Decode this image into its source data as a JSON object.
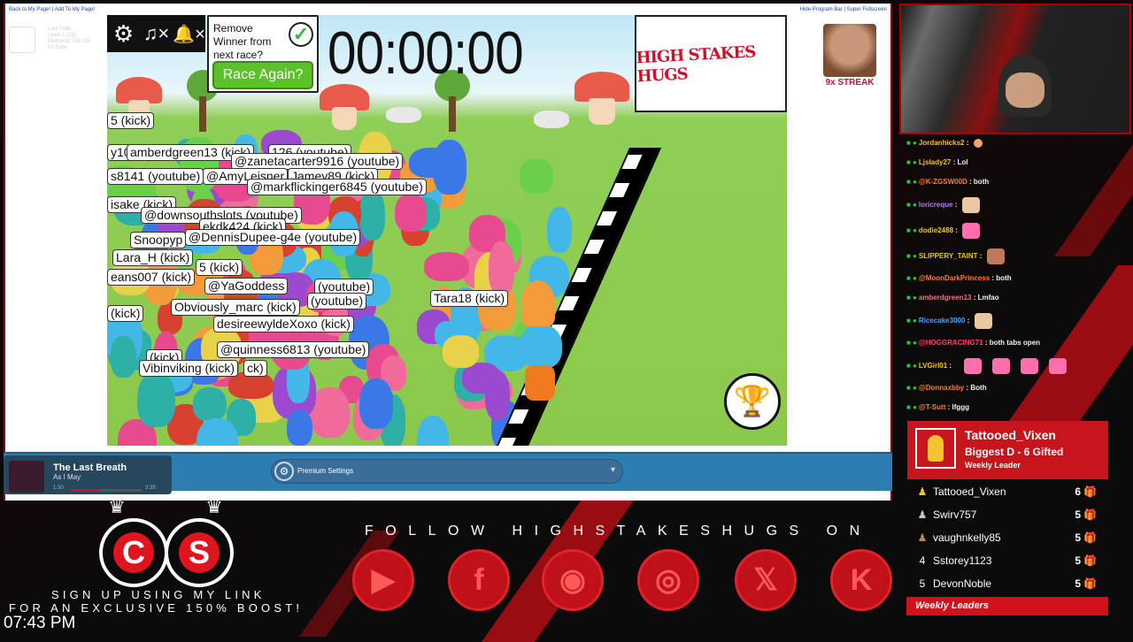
{
  "browser": {
    "top_left_links": "Back to My Page! | Add To My Page!",
    "top_right_links": "Hide Program Bar | Super Fullscreen",
    "ghost_profile": [
      "Last Train",
      "Level 1 (18)",
      "Elements:738 ±10",
      "10 Subs"
    ]
  },
  "game": {
    "timer": "00:00:00",
    "remove_winner_text": "Remove Winner from next race?",
    "race_again_label": "Race Again?",
    "logo_text": "HIGH STAKES HUGS",
    "streak_label": "9x STREAK",
    "name_tags": [
      "5 (kick)",
      "y10",
      "amberdgreen13 (kick)",
      "126 (youtube)",
      "@zanetacarter9916 (youtube)",
      "s8141 (youtube)",
      "@AmyLeisner",
      "Jamey89 (kick)",
      "@markflickinger6845 (youtube)",
      "isake (kick)",
      "@downsouthslots (youtube)",
      "ekdk424 (kick)",
      "Snoopyp",
      "@DennisDupee-g4e (youtube)",
      "Lara_H (kick)",
      "5 (kick)",
      "eans007 (kick)",
      "@YaGoddess",
      "(youtube)",
      "(youtube)",
      "Tara18 (kick)",
      "(kick)",
      "Obviously_marc (kick)",
      "desireewyldeXoxo (kick)",
      "@quinness6813 (youtube)",
      "(kick)",
      "Vibinviking (kick)",
      "ck)"
    ]
  },
  "music": {
    "title": "The Last Breath",
    "artist": "As I May",
    "time_current": "1:30",
    "time_total": "3:39"
  },
  "premium": {
    "label": "Premium Settings"
  },
  "chat": [
    {
      "name": "Jordanhicks2",
      "msg": "",
      "color": "#f0c419",
      "emote": "peach"
    },
    {
      "name": "Ljslady27",
      "msg": "Lol",
      "color": "#f0c419"
    },
    {
      "name": "@K-ZGSW00D",
      "msg": "both",
      "color": "#ff7b2e"
    },
    {
      "name": "loricreque",
      "msg": "",
      "color": "#b57cff",
      "emote": "cat"
    },
    {
      "name": "dodie2488",
      "msg": "",
      "color": "#f0c419",
      "emote": "pink"
    },
    {
      "name": "SLIPPERY_TAINT",
      "msg": "",
      "color": "#f0c419",
      "emote": "face"
    },
    {
      "name": "@MoonDarkPrincess",
      "msg": "both",
      "color": "#ff7b2e"
    },
    {
      "name": "amberdgreen13",
      "msg": "Lmfao",
      "color": "#ff6b8a"
    },
    {
      "name": "Ricecake3000",
      "msg": "",
      "color": "#4aa8ff",
      "emote": "cat"
    },
    {
      "name": "@HOGGRACING71",
      "msg": "both tabs open",
      "color": "#ff3a6e"
    },
    {
      "name": "LVGirl01",
      "msg": "",
      "color": "#f0c419",
      "emote": "pinks"
    },
    {
      "name": "@Donnaxbby",
      "msg": "Both",
      "color": "#ff7b2e"
    },
    {
      "name": "@T-Sutt",
      "msg": "lfggg",
      "color": "#ff7b2e"
    }
  ],
  "leaders": {
    "top_name": "Tattooed_Vixen",
    "top_sub": "Biggest D - 6 Gifted",
    "top_caption": "Weekly Leader",
    "rows": [
      {
        "rank": "",
        "name": "Tattooed_Vixen",
        "count": "6"
      },
      {
        "rank": "",
        "name": "Swirv757",
        "count": "5"
      },
      {
        "rank": "",
        "name": "vaughnkelly85",
        "count": "5"
      },
      {
        "rank": "4",
        "name": "Sstorey1123",
        "count": "5"
      },
      {
        "rank": "5",
        "name": "DevonNoble",
        "count": "5"
      }
    ],
    "footer": "Weekly Leaders"
  },
  "socials": {
    "follow_text": "FOLLOW HIGHSTAKESHUGS ON",
    "icons": [
      "youtube-icon",
      "facebook-icon",
      "discord-icon",
      "instagram-icon",
      "x-icon",
      "kick-icon"
    ]
  },
  "promo": {
    "logo_letters": [
      "C",
      "S"
    ],
    "line1": "SIGN UP USING MY LINK",
    "line2": "FOR AN EXCLUSIVE 150% BOOST!"
  },
  "clock": "07:43 PM",
  "colors": {
    "accent_red": "#c8141c",
    "kick_green": "#2ac34a",
    "bar_blue": "#2d7db3"
  }
}
